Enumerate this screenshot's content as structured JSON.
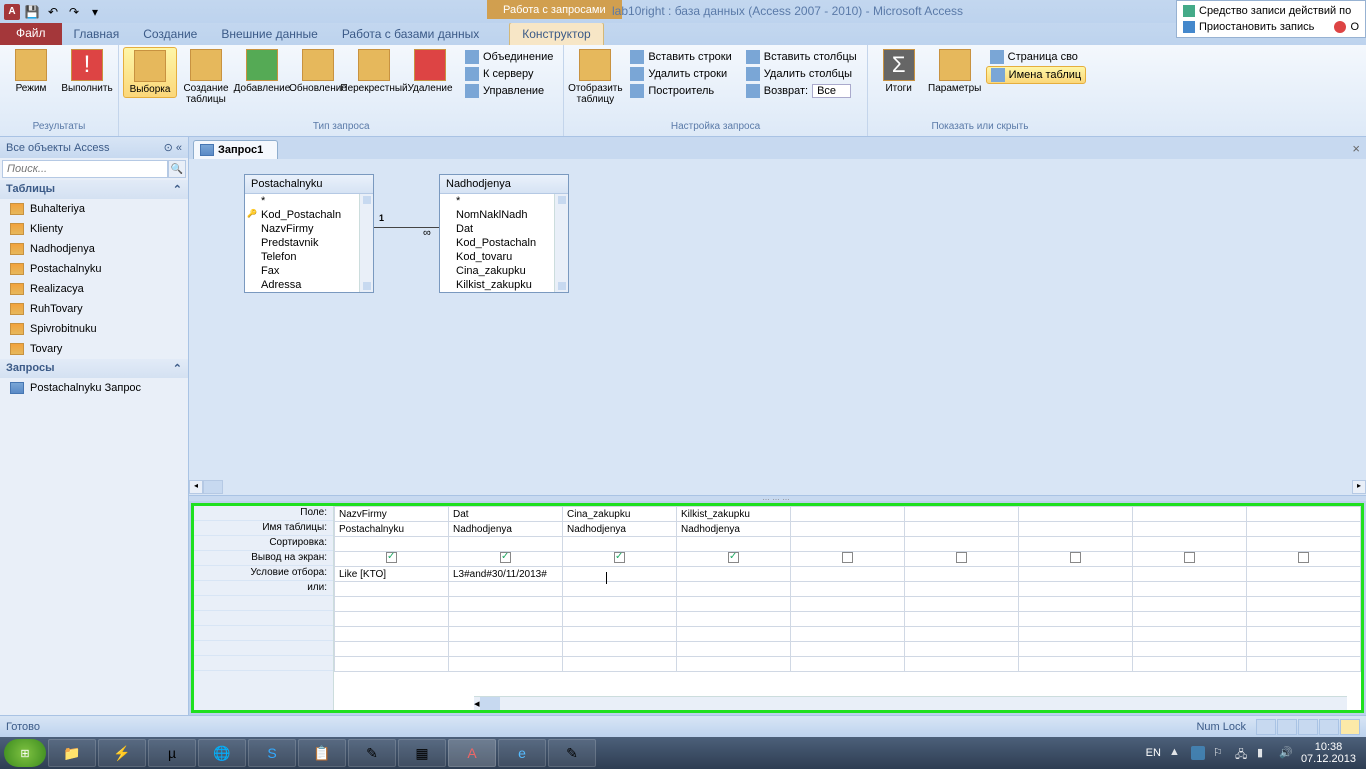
{
  "titlebar": {
    "title": "lab10right : база данных (Access 2007 - 2010) - Microsoft Access",
    "context_title": "Работа с запросами",
    "recorder_line1": "Средство записи действий по",
    "recorder_line2": "Приостановить запись",
    "recorder_stop": "О"
  },
  "tabs": {
    "file": "Файл",
    "home": "Главная",
    "create": "Создание",
    "external": "Внешние данные",
    "dbtools": "Работа с базами данных",
    "design": "Конструктор"
  },
  "ribbon": {
    "results": {
      "label": "Результаты",
      "mode": "Режим",
      "run": "Выполнить"
    },
    "querytype": {
      "label": "Тип запроса",
      "select": "Выборка",
      "maketable": "Создание\nтаблицы",
      "append": "Добавление",
      "update": "Обновление",
      "crosstab": "Перекрестный",
      "delete": "Удаление",
      "union": "Объединение",
      "passthrough": "К серверу",
      "datadef": "Управление"
    },
    "setup": {
      "label": "Настройка запроса",
      "showtable": "Отобразить\nтаблицу",
      "ins_rows": "Вставить строки",
      "del_rows": "Удалить строки",
      "builder": "Построитель",
      "ins_cols": "Вставить столбцы",
      "del_cols": "Удалить столбцы",
      "return_lbl": "Возврат:",
      "return_val": "Все"
    },
    "showhide": {
      "label": "Показать или скрыть",
      "totals": "Итоги",
      "params": "Параметры",
      "propsheet": "Страница сво",
      "tablenames": "Имена таблиц"
    }
  },
  "nav": {
    "header": "Все объекты Access",
    "search_ph": "Поиск...",
    "tables_h": "Таблицы",
    "queries_h": "Запросы",
    "tables": [
      "Buhalteriya",
      "Klienty",
      "Nadhodjenya",
      "Postachalnyku",
      "Realizacya",
      "RuhTovary",
      "Spivrobitnuku",
      "Tovary"
    ],
    "queries": [
      "Postachalnyku Запрос"
    ]
  },
  "doc": {
    "tab": "Запрос1",
    "t1": {
      "name": "Postachalnyku",
      "fields": [
        "*",
        "Kod_Postachaln",
        "NazvFirmy",
        "Predstavnik",
        "Telefon",
        "Fax",
        "Adressa"
      ]
    },
    "t2": {
      "name": "Nadhodjenya",
      "fields": [
        "*",
        "NomNaklNadh",
        "Dat",
        "Kod_Postachaln",
        "Kod_tovaru",
        "Cina_zakupku",
        "Kilkist_zakupku"
      ]
    }
  },
  "qbe": {
    "rows": {
      "field": "Поле:",
      "table": "Имя таблицы:",
      "sort": "Сортировка:",
      "show": "Вывод на экран:",
      "criteria": "Условие отбора:",
      "or": "или:"
    },
    "cols": [
      {
        "field": "NazvFirmy",
        "table": "Postachalnyku",
        "show": true,
        "criteria": "Like [KTO]"
      },
      {
        "field": "Dat",
        "table": "Nadhodjenya",
        "show": true,
        "criteria": "L3#and#30/11/2013#"
      },
      {
        "field": "Cina_zakupku",
        "table": "Nadhodjenya",
        "show": true,
        "criteria": ""
      },
      {
        "field": "Kilkist_zakupku",
        "table": "Nadhodjenya",
        "show": true,
        "criteria": ""
      }
    ]
  },
  "status": {
    "ready": "Готово",
    "numlock": "Num Lock"
  },
  "tray": {
    "lang": "EN",
    "time": "10:38",
    "date": "07.12.2013"
  }
}
